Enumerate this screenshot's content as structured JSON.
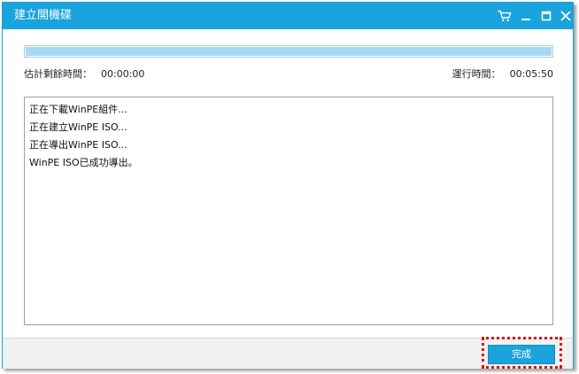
{
  "window": {
    "title": "建立開機碟",
    "icons": [
      "cart-icon",
      "minimize-icon",
      "maximize-icon",
      "close-icon"
    ],
    "accent_color": "#1aa3dd"
  },
  "progress": {
    "fraction": 1.0,
    "fill_color": "#a7d8f4"
  },
  "status": {
    "remaining_label": "估計剩餘時間：",
    "remaining_value": "00:00:00",
    "elapsed_label": "運行時間：",
    "elapsed_value": "00:05:50"
  },
  "log": {
    "lines": [
      "正在下載WinPE組件...",
      "正在建立WinPE ISO...",
      "正在導出WinPE ISO...",
      "WinPE ISO已成功導出。"
    ]
  },
  "footer": {
    "done_label": "完成"
  }
}
